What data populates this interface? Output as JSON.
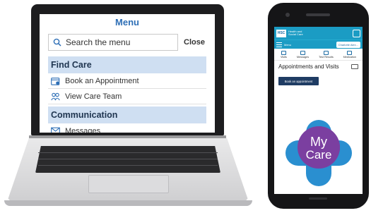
{
  "laptop": {
    "menu_title": "Menu",
    "search": {
      "placeholder": "Search the menu",
      "close_label": "Close"
    },
    "sections": [
      {
        "title": "Find Care",
        "items": [
          {
            "label": "Book an Appointment",
            "icon": "calendar-icon"
          },
          {
            "label": "View Care Team",
            "icon": "people-icon"
          }
        ]
      },
      {
        "title": "Communication",
        "items": [
          {
            "label": "Messages",
            "icon": "envelope-icon"
          }
        ]
      }
    ],
    "accent_color": "#2e6fb6",
    "section_bg_color": "#cfdff2"
  },
  "phone": {
    "header": {
      "logo_text": "HSC",
      "org_name": "Health and Social Care",
      "menu_label": "Menu",
      "user_label": "Charlotte Alex..."
    },
    "tabs": [
      {
        "label": "Visits",
        "icon": "visits-icon"
      },
      {
        "label": "Messages",
        "icon": "envelope-icon"
      },
      {
        "label": "Test Results",
        "icon": "test-results-icon"
      },
      {
        "label": "Medication",
        "icon": "medication-icon"
      }
    ],
    "page_title": "Appointments and Visits",
    "book_button_label": "Book an appointment",
    "logo": {
      "word_1": "My",
      "word_2": "Care",
      "purple": "#7b3fa0",
      "blue": "#2a8fd0"
    },
    "header_color": "#1b9cc4",
    "button_color": "#1f3c63"
  }
}
